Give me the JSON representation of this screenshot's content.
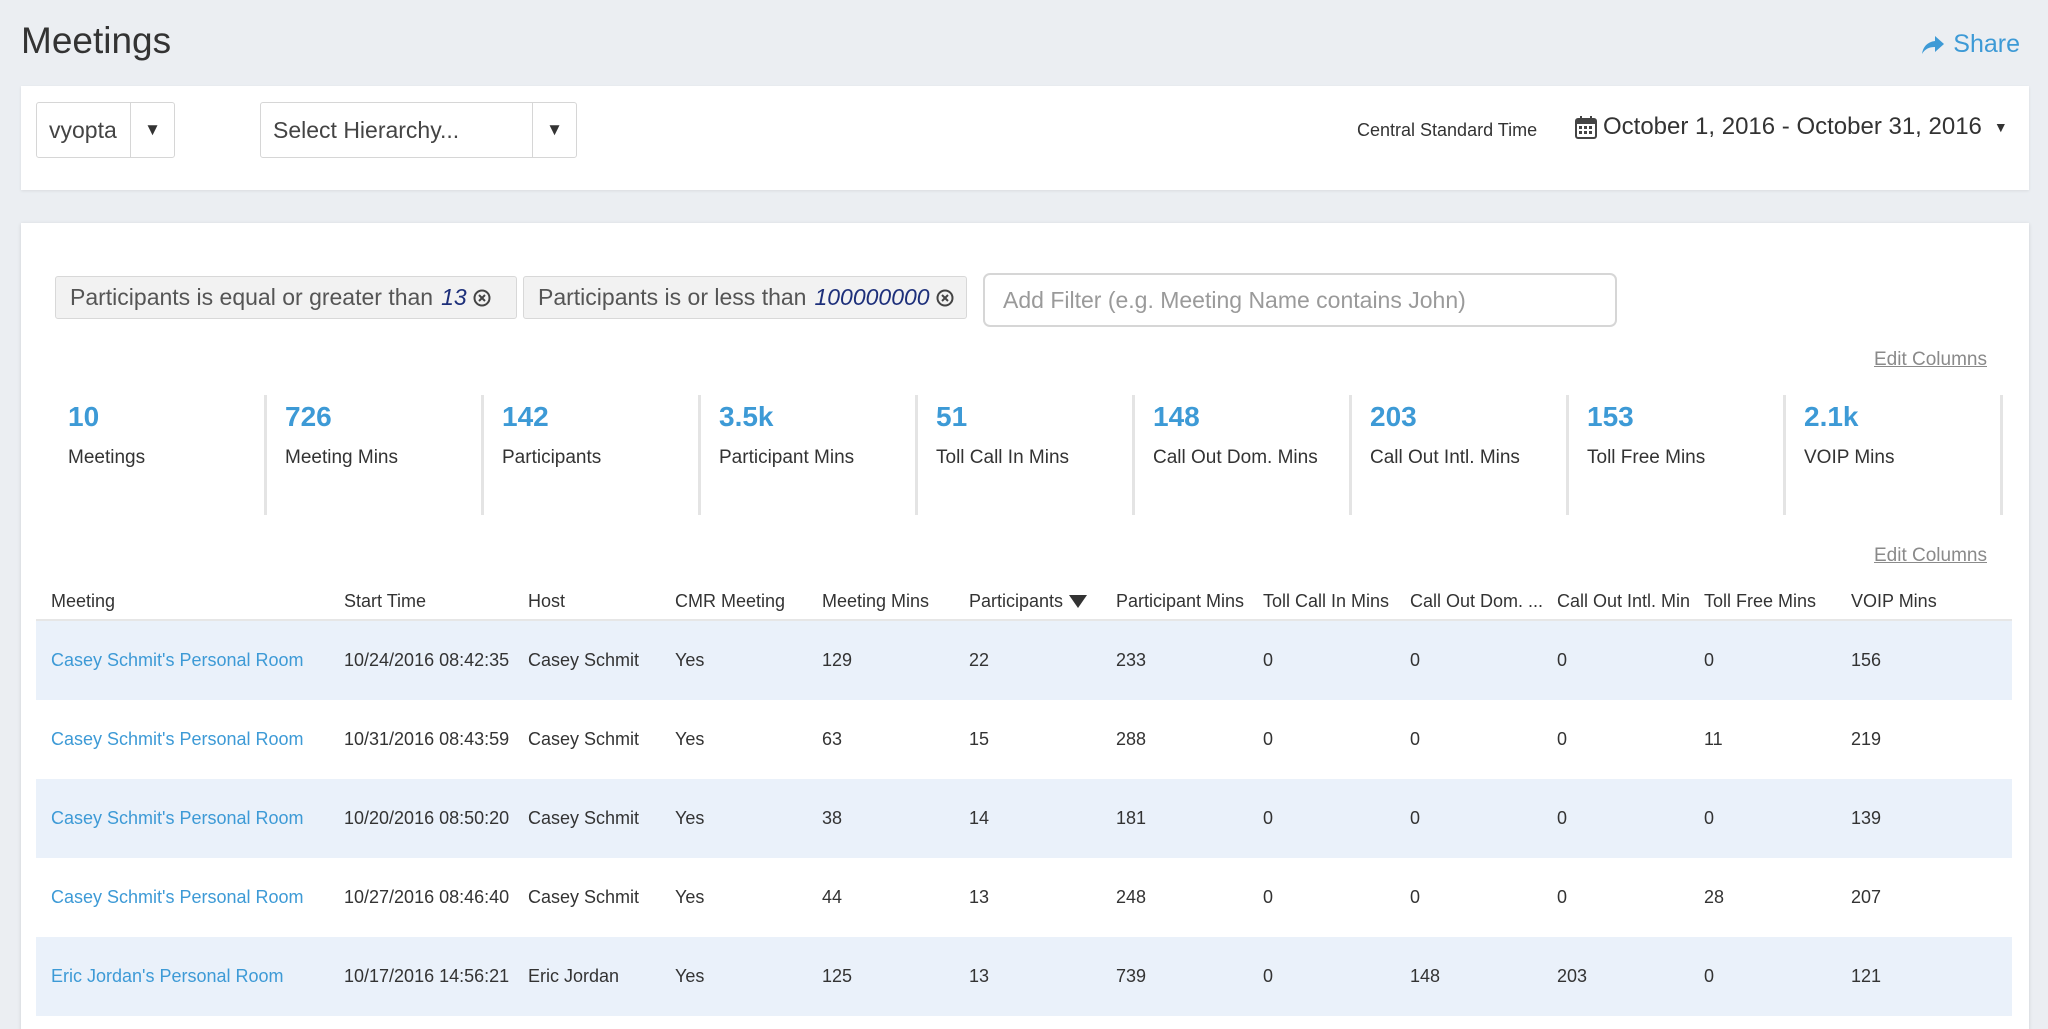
{
  "page": {
    "title": "Meetings",
    "share_label": "Share"
  },
  "filters": {
    "company": "vyopta",
    "hierarchy_placeholder": "Select Hierarchy...",
    "timezone": "Central Standard Time",
    "date_range": "October 1, 2016 - October 31, 2016"
  },
  "chips": [
    {
      "label": "Participants is equal or greater than",
      "value": "13"
    },
    {
      "label": "Participants is or less than",
      "value": "100000000"
    }
  ],
  "add_filter_placeholder": "Add Filter (e.g. Meeting Name contains John)",
  "edit_columns_label": "Edit Columns",
  "stats": [
    {
      "value": "10",
      "label": "Meetings"
    },
    {
      "value": "726",
      "label": "Meeting Mins"
    },
    {
      "value": "142",
      "label": "Participants"
    },
    {
      "value": "3.5k",
      "label": "Participant Mins"
    },
    {
      "value": "51",
      "label": "Toll Call In Mins"
    },
    {
      "value": "148",
      "label": "Call Out Dom. Mins"
    },
    {
      "value": "203",
      "label": "Call Out Intl. Mins"
    },
    {
      "value": "153",
      "label": "Toll Free Mins"
    },
    {
      "value": "2.1k",
      "label": "VOIP Mins"
    }
  ],
  "table": {
    "headers": [
      "Meeting",
      "Start Time",
      "Host",
      "CMR Meeting",
      "Meeting Mins",
      "Participants",
      "Participant Mins",
      "Toll Call In Mins",
      "Call Out Dom. ...",
      "Call Out Intl. Mins",
      "Toll Free Mins",
      "VOIP Mins"
    ],
    "rows": [
      [
        "Casey Schmit's Personal Room",
        "10/24/2016 08:42:35",
        "Casey Schmit",
        "Yes",
        "129",
        "22",
        "233",
        "0",
        "0",
        "0",
        "0",
        "156"
      ],
      [
        "Casey Schmit's Personal Room",
        "10/31/2016 08:43:59",
        "Casey Schmit",
        "Yes",
        "63",
        "15",
        "288",
        "0",
        "0",
        "0",
        "11",
        "219"
      ],
      [
        "Casey Schmit's Personal Room",
        "10/20/2016 08:50:20",
        "Casey Schmit",
        "Yes",
        "38",
        "14",
        "181",
        "0",
        "0",
        "0",
        "0",
        "139"
      ],
      [
        "Casey Schmit's Personal Room",
        "10/27/2016 08:46:40",
        "Casey Schmit",
        "Yes",
        "44",
        "13",
        "248",
        "0",
        "0",
        "0",
        "28",
        "207"
      ],
      [
        "Eric Jordan's Personal Room",
        "10/17/2016 14:56:21",
        "Eric Jordan",
        "Yes",
        "125",
        "13",
        "739",
        "0",
        "148",
        "203",
        "0",
        "121"
      ]
    ]
  }
}
